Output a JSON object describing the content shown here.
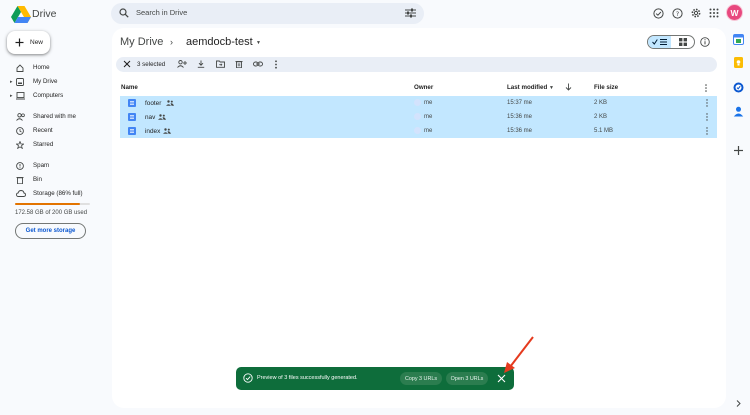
{
  "header": {
    "app_name": "Drive",
    "search_placeholder": "Search in Drive",
    "avatar_initial": "W"
  },
  "sidebar": {
    "new_label": "New",
    "items": [
      {
        "label": "Home",
        "icon": "home-icon"
      },
      {
        "label": "My Drive",
        "icon": "my-drive-icon"
      },
      {
        "label": "Computers",
        "icon": "computers-icon"
      },
      {
        "label": "Shared with me",
        "icon": "shared-icon"
      },
      {
        "label": "Recent",
        "icon": "clock-icon"
      },
      {
        "label": "Starred",
        "icon": "star-icon"
      },
      {
        "label": "Spam",
        "icon": "spam-icon"
      },
      {
        "label": "Bin",
        "icon": "trash-icon"
      },
      {
        "label": "Storage (86% full)",
        "icon": "cloud-icon"
      }
    ],
    "storage_percent": 86,
    "storage_text": "172.58 GB of 200 GB used",
    "get_more_storage": "Get more storage"
  },
  "breadcrumb": {
    "root": "My Drive",
    "separator": "›",
    "folder": "aemdocb-test"
  },
  "selection": {
    "count_label": "3 selected"
  },
  "table": {
    "columns": {
      "name": "Name",
      "owner": "Owner",
      "modified": "Last modified",
      "size": "File size"
    },
    "rows": [
      {
        "name": "footer",
        "owner": "me",
        "modified": "15:37 me",
        "size": "2 KB"
      },
      {
        "name": "nav",
        "owner": "me",
        "modified": "15:36 me",
        "size": "2 KB"
      },
      {
        "name": "index",
        "owner": "me",
        "modified": "15:36 me",
        "size": "5.1 MB"
      }
    ]
  },
  "toast": {
    "message": "Preview of 3 files successfully generated.",
    "copy_label": "Copy 3 URLs",
    "open_label": "Open 3 URLs"
  },
  "colors": {
    "accent": "#0b57d0",
    "selected_row": "#c2e7ff",
    "toast_bg": "#0e6d3b",
    "storage": "#e37400",
    "annotation_arrow": "#e53a1e"
  }
}
